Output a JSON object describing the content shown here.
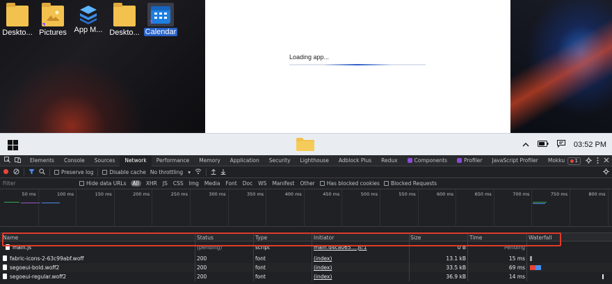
{
  "desktop": {
    "icons": [
      {
        "label": "Deskto...",
        "icon": "folder-icon"
      },
      {
        "label": "Pictures",
        "icon": "pictures-folder-icon"
      },
      {
        "label": "App M...",
        "icon": "app-manager-icon"
      },
      {
        "label": "Deskto...",
        "icon": "folder-icon"
      },
      {
        "label": "Calendar",
        "icon": "calendar-icon",
        "selected": true
      }
    ]
  },
  "app_window": {
    "loading_text": "Loading app...",
    "loading_progress": 0.5
  },
  "taskbar": {
    "time": "03:52 PM",
    "icons": [
      "windows-start-icon",
      "file-explorer-icon",
      "chevron-up-icon",
      "battery-icon",
      "notification-icon"
    ]
  },
  "devtools": {
    "tabs": [
      "Elements",
      "Console",
      "Sources",
      "Network",
      "Performance",
      "Memory",
      "Application",
      "Security",
      "Lighthouse",
      "Adblock Plus",
      "Redux",
      "Components",
      "Profiler",
      "JavaScript Profiler",
      "Mokku"
    ],
    "active_tab": "Network",
    "error_count": "1",
    "toolbar": {
      "preserve_log": "Preserve log",
      "disable_cache": "Disable cache",
      "throttling": "No throttling"
    },
    "filter": {
      "placeholder": "Filter",
      "hide_data_urls": "Hide data URLs",
      "types": [
        "All",
        "XHR",
        "JS",
        "CSS",
        "Img",
        "Media",
        "Font",
        "Doc",
        "WS",
        "Manifest",
        "Other"
      ],
      "active_type": "All",
      "has_blocked_cookies": "Has blocked cookies",
      "blocked_requests": "Blocked Requests"
    },
    "timeline_ticks": [
      "50 ms",
      "100 ms",
      "150 ms",
      "200 ms",
      "250 ms",
      "300 ms",
      "350 ms",
      "400 ms",
      "450 ms",
      "500 ms",
      "550 ms",
      "600 ms",
      "650 ms",
      "700 ms",
      "750 ms",
      "800 ms"
    ],
    "columns": {
      "name": "Name",
      "status": "Status",
      "type": "Type",
      "initiator": "Initiator",
      "size": "Size",
      "time": "Time",
      "waterfall": "Waterfall"
    },
    "rows": [
      {
        "name": "main.js",
        "status": "(pending)",
        "type": "script",
        "initiator": "main.d4ca065....js:1",
        "size": "0 B",
        "time": "Pending"
      },
      {
        "name": "fabric-icons-2-63c99abf.woff",
        "status": "200",
        "type": "font",
        "initiator": "(index)",
        "size": "13.1 kB",
        "time": "15 ms"
      },
      {
        "name": "segoeui-bold.woff2",
        "status": "200",
        "type": "font",
        "initiator": "(index)",
        "size": "33.5 kB",
        "time": "69 ms"
      },
      {
        "name": "segoeui-regular.woff2",
        "status": "200",
        "type": "font",
        "initiator": "(index)",
        "size": "36.9 kB",
        "time": "14 ms"
      }
    ]
  }
}
